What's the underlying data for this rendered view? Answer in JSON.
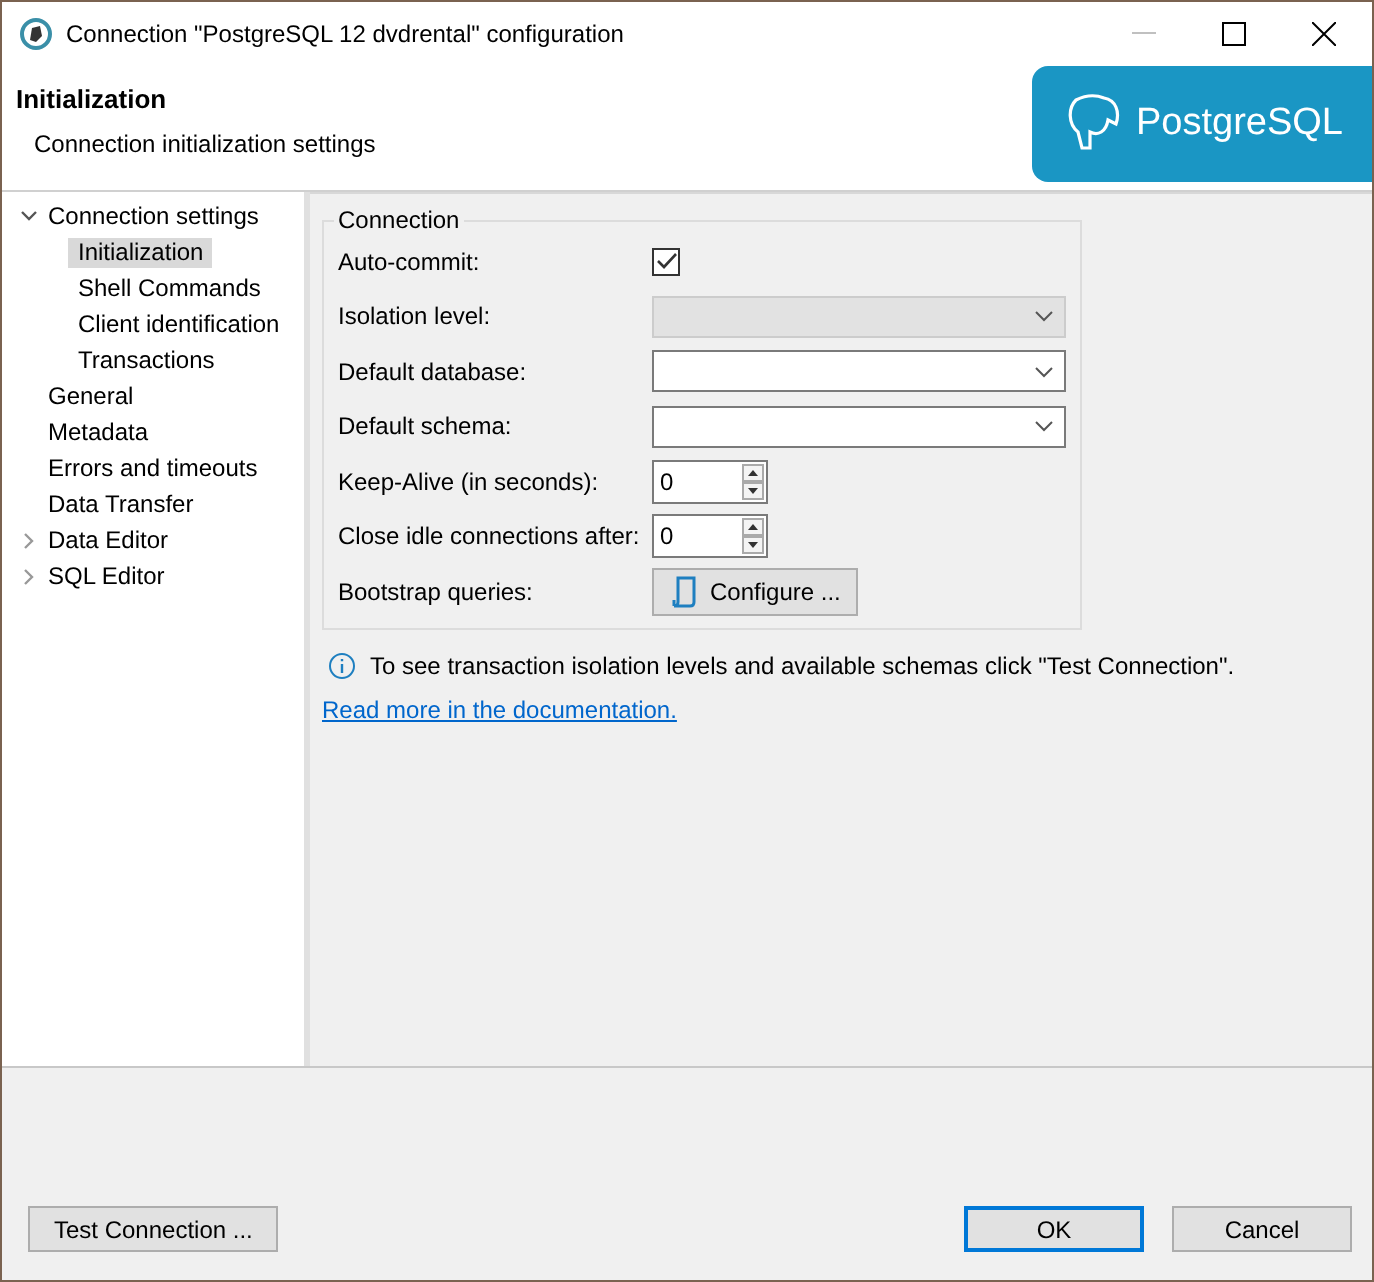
{
  "window": {
    "title": "Connection \"PostgreSQL 12 dvdrental\" configuration"
  },
  "header": {
    "title": "Initialization",
    "subtitle": "Connection initialization settings",
    "logo_text": "PostgreSQL"
  },
  "tree": [
    {
      "label": "Connection settings",
      "expanded": true,
      "selected": false,
      "children": [
        {
          "label": "Initialization",
          "selected": true
        },
        {
          "label": "Shell Commands",
          "selected": false
        },
        {
          "label": "Client identification",
          "selected": false
        },
        {
          "label": "Transactions",
          "selected": false
        }
      ]
    },
    {
      "label": "General",
      "selected": false
    },
    {
      "label": "Metadata",
      "selected": false
    },
    {
      "label": "Errors and timeouts",
      "selected": false
    },
    {
      "label": "Data Transfer",
      "selected": false
    },
    {
      "label": "Data Editor",
      "expanded": false,
      "selected": false
    },
    {
      "label": "SQL Editor",
      "expanded": false,
      "selected": false
    }
  ],
  "group": {
    "title": "Connection",
    "fields": [
      {
        "kind": "checkbox",
        "label": "Auto-commit:",
        "checked": true
      },
      {
        "kind": "combo",
        "label": "Isolation level:",
        "disabled": true
      },
      {
        "kind": "combo",
        "label": "Default database:",
        "disabled": false
      },
      {
        "kind": "combo",
        "label": "Default schema:",
        "disabled": false
      },
      {
        "kind": "spinner",
        "label": "Keep-Alive (in seconds):",
        "value": "0"
      },
      {
        "kind": "spinner",
        "label": "Close idle connections after:",
        "value": "0"
      },
      {
        "kind": "button",
        "label": "Bootstrap queries:",
        "button": "Configure ..."
      }
    ]
  },
  "info": "To see transaction isolation levels and available schemas click \"Test Connection\".",
  "link": "Read more in the documentation.",
  "buttons": {
    "test": "Test Connection ...",
    "ok": "OK",
    "cancel": "Cancel"
  }
}
